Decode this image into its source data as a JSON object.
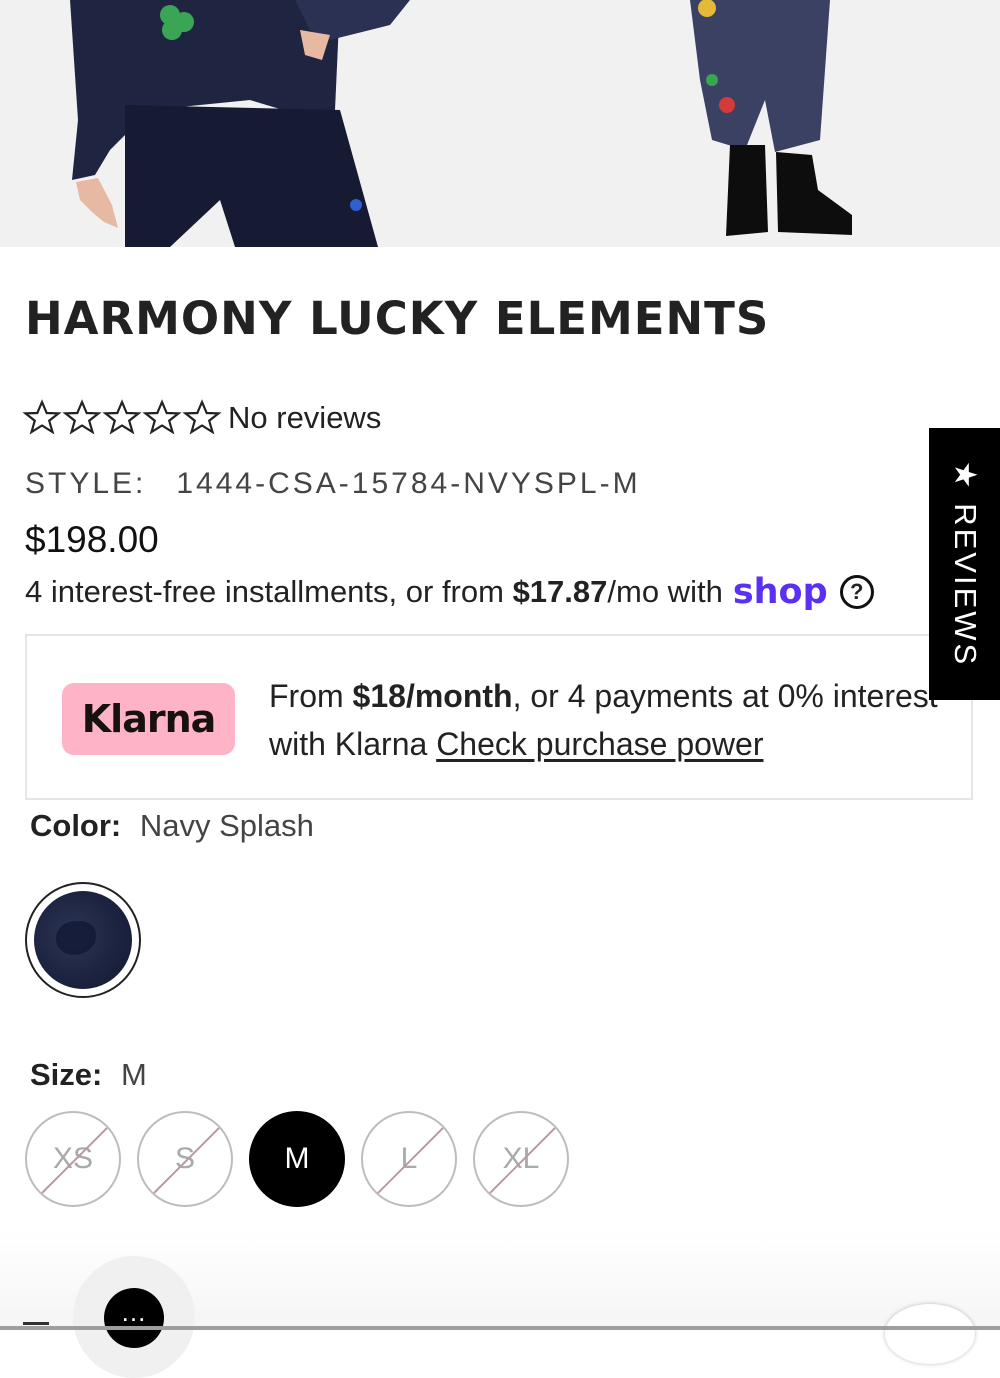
{
  "product": {
    "title": "HARMONY LUCKY ELEMENTS",
    "rating_text": "No reviews",
    "rating_stars": 0,
    "style_label": "STYLE:",
    "style_value": "1444-CSA-15784-NVYSPL-M",
    "price": "$198.00"
  },
  "shop_pay": {
    "text_before": "4 interest-free installments, or from ",
    "amount": "$17.87",
    "text_after": "/mo with",
    "brand": "shop",
    "help_glyph": "?"
  },
  "klarna": {
    "badge": "Klarna",
    "text_pre": "From ",
    "amount": "$18/month",
    "text_mid": ", or 4 payments at 0% interest with Klarna ",
    "link": "Check purchase power"
  },
  "reviews_tab": {
    "label": "★ REVIEWS"
  },
  "color": {
    "label": "Color:",
    "value": "Navy Splash"
  },
  "size": {
    "label": "Size:",
    "value": "M",
    "options": [
      "XS",
      "S",
      "M",
      "L",
      "XL"
    ]
  },
  "chat": {
    "glyph": "..."
  },
  "colors": {
    "accent_shop": "#5a31f4",
    "klarna_pink": "#ffb3c7"
  }
}
